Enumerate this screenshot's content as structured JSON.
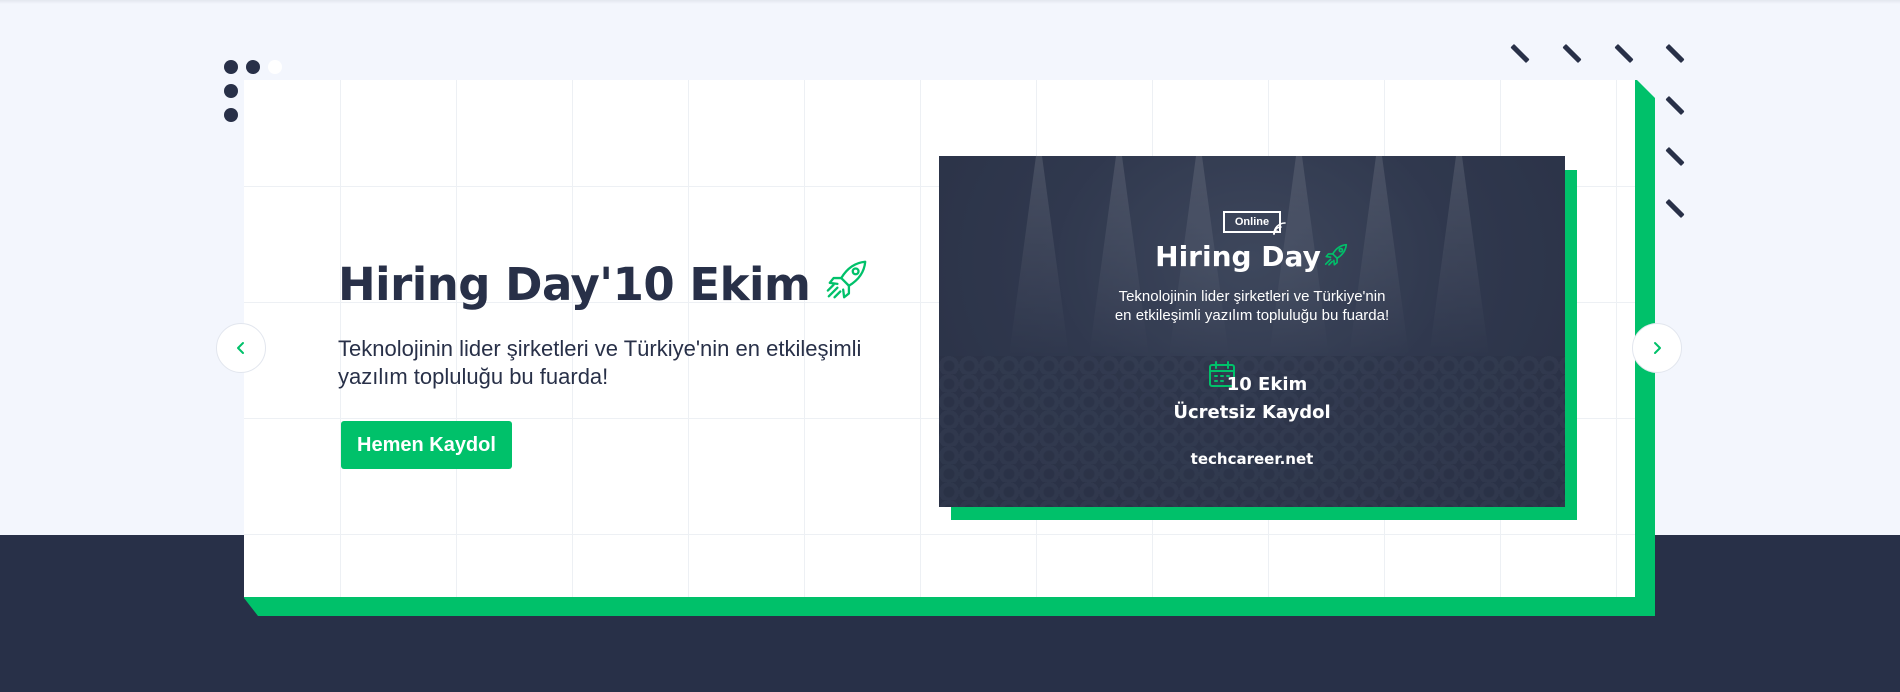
{
  "hero": {
    "title": "Hiring Day'10 Ekim",
    "subtitle": "Teknolojinin lider şirketleri ve Türkiye'nin en etkileşimli yazılım topluluğu bu fuarda!",
    "cta_label": "Hemen Kaydol"
  },
  "banner": {
    "badge": "Online",
    "title": "Hiring Day",
    "subtitle_line1": "Teknolojinin lider şirketleri ve Türkiye'nin",
    "subtitle_line2": "en etkileşimli yazılım topluluğu bu fuarda!",
    "date": "10 Ekim",
    "registration": "Ücretsiz Kaydol",
    "url": "techcareer.net"
  },
  "carousel": {
    "prev_icon": "chevron-left-icon",
    "next_icon": "chevron-right-icon"
  },
  "colors": {
    "brand_green": "#00c16a",
    "navy": "#283048",
    "page_bg": "#f3f6fd"
  }
}
